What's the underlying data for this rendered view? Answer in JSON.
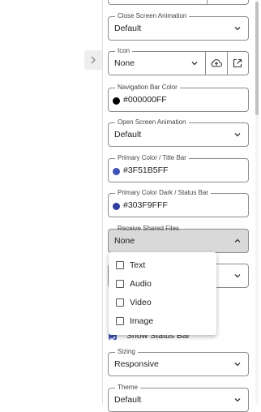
{
  "fields": {
    "close_anim": {
      "label": "Close Screen Animation",
      "value": "Default"
    },
    "icon": {
      "label": "Icon",
      "value": "None"
    },
    "nav_bar_color": {
      "label": "Navigation Bar Color",
      "value": "#000000FF"
    },
    "open_anim": {
      "label": "Open Screen Animation",
      "value": "Default"
    },
    "primary_color": {
      "label": "Primary Color / Title Bar",
      "value": "#3F51B5FF"
    },
    "primary_dark": {
      "label": "Primary Color Dark / Status Bar",
      "value": "#303F9FFF"
    },
    "receive_files": {
      "label": "Receive Shared Files",
      "value": "None"
    },
    "sizing": {
      "label": "Sizing",
      "value": "Responsive"
    },
    "theme": {
      "label": "Theme",
      "value": "Default"
    }
  },
  "dropdown_options": [
    "Text",
    "Audio",
    "Video",
    "Image"
  ],
  "show_status_bar": {
    "label": "Show Status Bar",
    "checked": true
  },
  "colors": {
    "nav_bar": "#000000",
    "primary": "#3F51B5",
    "primary_dark": "#303F9F",
    "checkbox_accent": "#3F51B5"
  },
  "icons": {
    "collapse": "chevron-right-icon",
    "select_arrow": "chevron-down-icon",
    "open_arrow": "chevron-up-icon",
    "upload": "cloud-upload-icon",
    "external": "open-in-new-icon"
  }
}
